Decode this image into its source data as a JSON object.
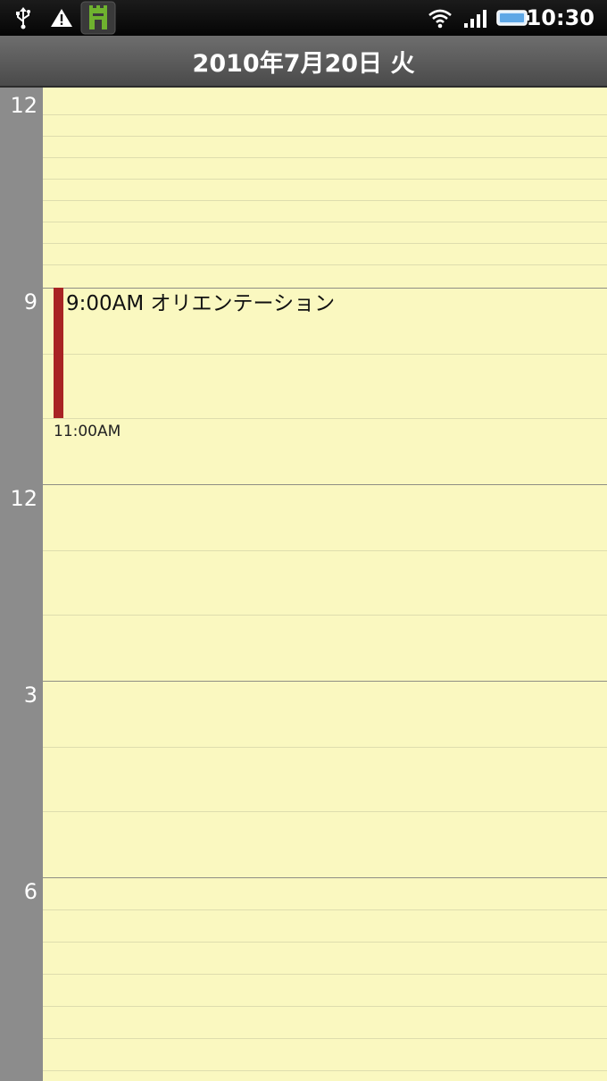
{
  "status_bar": {
    "time": "10:30",
    "left_icons": [
      "usb-icon",
      "warning-icon",
      "app-notification-icon"
    ],
    "right_icons": [
      "wifi-icon",
      "signal-icon",
      "battery-icon"
    ]
  },
  "header": {
    "date": "2010年7月20日 火"
  },
  "timeline": {
    "hour_labels": [
      "12",
      "9",
      "12",
      "3",
      "6"
    ]
  },
  "event": {
    "title": "9:00AM オリエンテーション",
    "end_time": "11:00AM",
    "color": "#a82424"
  }
}
